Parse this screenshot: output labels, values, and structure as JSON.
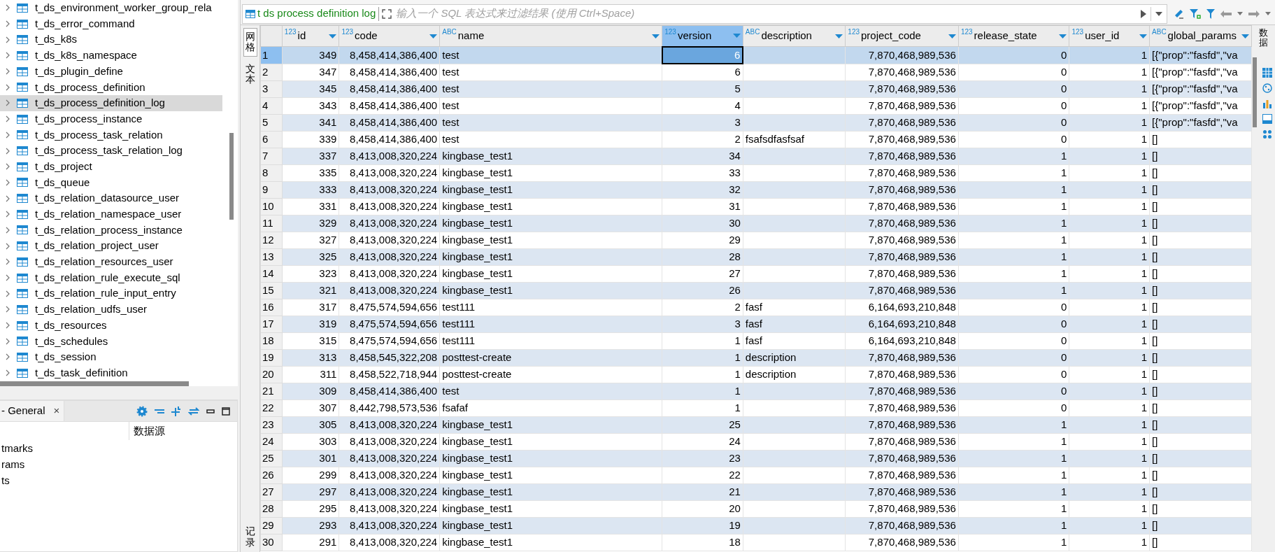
{
  "navigator": {
    "items": [
      {
        "label": "t_ds_environment_worker_group_rela",
        "selected": false
      },
      {
        "label": "t_ds_error_command",
        "selected": false
      },
      {
        "label": "t_ds_k8s",
        "selected": false
      },
      {
        "label": "t_ds_k8s_namespace",
        "selected": false
      },
      {
        "label": "t_ds_plugin_define",
        "selected": false
      },
      {
        "label": "t_ds_process_definition",
        "selected": false
      },
      {
        "label": "t_ds_process_definition_log",
        "selected": true
      },
      {
        "label": "t_ds_process_instance",
        "selected": false
      },
      {
        "label": "t_ds_process_task_relation",
        "selected": false
      },
      {
        "label": "t_ds_process_task_relation_log",
        "selected": false
      },
      {
        "label": "t_ds_project",
        "selected": false
      },
      {
        "label": "t_ds_queue",
        "selected": false
      },
      {
        "label": "t_ds_relation_datasource_user",
        "selected": false
      },
      {
        "label": "t_ds_relation_namespace_user",
        "selected": false
      },
      {
        "label": "t_ds_relation_process_instance",
        "selected": false
      },
      {
        "label": "t_ds_relation_project_user",
        "selected": false
      },
      {
        "label": "t_ds_relation_resources_user",
        "selected": false
      },
      {
        "label": "t_ds_relation_rule_execute_sql",
        "selected": false
      },
      {
        "label": "t_ds_relation_rule_input_entry",
        "selected": false
      },
      {
        "label": "t_ds_relation_udfs_user",
        "selected": false
      },
      {
        "label": "t_ds_resources",
        "selected": false
      },
      {
        "label": "t_ds_schedules",
        "selected": false
      },
      {
        "label": "t_ds_session",
        "selected": false
      },
      {
        "label": "t_ds_task_definition",
        "selected": false
      }
    ]
  },
  "bottom_panel": {
    "tab": "- General",
    "close": "×",
    "column_header": "数据源",
    "items": [
      "tmarks",
      "rams",
      "ts"
    ]
  },
  "editor": {
    "tab_title": "t ds process definition log",
    "filter": {
      "placeholder": "输入一个 SQL 表达式来过滤结果 (使用 Ctrl+Space)"
    },
    "side_tabs": [
      {
        "label": "网格",
        "selected": true
      },
      {
        "label": "文本",
        "selected": false
      }
    ],
    "side_tab_bottom": "记录",
    "right_tab": "数据",
    "columns": [
      {
        "type": "123",
        "label": "id",
        "selected": false
      },
      {
        "type": "123",
        "label": "code",
        "selected": false
      },
      {
        "type": "ABC",
        "label": "name",
        "selected": false
      },
      {
        "type": "123",
        "label": "version",
        "selected": true
      },
      {
        "type": "ABC",
        "label": "description",
        "selected": false
      },
      {
        "type": "123",
        "label": "project_code",
        "selected": false
      },
      {
        "type": "123",
        "label": "release_state",
        "selected": false
      },
      {
        "type": "123",
        "label": "user_id",
        "selected": false
      },
      {
        "type": "ABC",
        "label": "global_params",
        "selected": false
      }
    ],
    "rows": [
      {
        "n": "1",
        "cells": [
          "349",
          "8,458,414,386,400",
          "test",
          "6",
          null,
          "7,870,468,989,536",
          "0",
          "1",
          "[{\"prop\":\"fasfd\",\"va"
        ],
        "selected": true
      },
      {
        "n": "2",
        "cells": [
          "347",
          "8,458,414,386,400",
          "test",
          "6",
          null,
          "7,870,468,989,536",
          "0",
          "1",
          "[{\"prop\":\"fasfd\",\"va"
        ],
        "selected": false
      },
      {
        "n": "3",
        "cells": [
          "345",
          "8,458,414,386,400",
          "test",
          "5",
          null,
          "7,870,468,989,536",
          "0",
          "1",
          "[{\"prop\":\"fasfd\",\"va"
        ],
        "selected": false
      },
      {
        "n": "4",
        "cells": [
          "343",
          "8,458,414,386,400",
          "test",
          "4",
          null,
          "7,870,468,989,536",
          "0",
          "1",
          "[{\"prop\":\"fasfd\",\"va"
        ],
        "selected": false
      },
      {
        "n": "5",
        "cells": [
          "341",
          "8,458,414,386,400",
          "test",
          "3",
          null,
          "7,870,468,989,536",
          "0",
          "1",
          "[{\"prop\":\"fasfd\",\"va"
        ],
        "selected": false
      },
      {
        "n": "6",
        "cells": [
          "339",
          "8,458,414,386,400",
          "test",
          "2",
          "fsafsdfasfsaf",
          "7,870,468,989,536",
          "0",
          "1",
          "[]"
        ],
        "selected": false
      },
      {
        "n": "7",
        "cells": [
          "337",
          "8,413,008,320,224",
          "kingbase_test1",
          "34",
          null,
          "7,870,468,989,536",
          "1",
          "1",
          "[]"
        ],
        "selected": false
      },
      {
        "n": "8",
        "cells": [
          "335",
          "8,413,008,320,224",
          "kingbase_test1",
          "33",
          null,
          "7,870,468,989,536",
          "1",
          "1",
          "[]"
        ],
        "selected": false
      },
      {
        "n": "9",
        "cells": [
          "333",
          "8,413,008,320,224",
          "kingbase_test1",
          "32",
          null,
          "7,870,468,989,536",
          "1",
          "1",
          "[]"
        ],
        "selected": false
      },
      {
        "n": "10",
        "cells": [
          "331",
          "8,413,008,320,224",
          "kingbase_test1",
          "31",
          null,
          "7,870,468,989,536",
          "1",
          "1",
          "[]"
        ],
        "selected": false
      },
      {
        "n": "11",
        "cells": [
          "329",
          "8,413,008,320,224",
          "kingbase_test1",
          "30",
          null,
          "7,870,468,989,536",
          "1",
          "1",
          "[]"
        ],
        "selected": false
      },
      {
        "n": "12",
        "cells": [
          "327",
          "8,413,008,320,224",
          "kingbase_test1",
          "29",
          null,
          "7,870,468,989,536",
          "1",
          "1",
          "[]"
        ],
        "selected": false
      },
      {
        "n": "13",
        "cells": [
          "325",
          "8,413,008,320,224",
          "kingbase_test1",
          "28",
          null,
          "7,870,468,989,536",
          "1",
          "1",
          "[]"
        ],
        "selected": false
      },
      {
        "n": "14",
        "cells": [
          "323",
          "8,413,008,320,224",
          "kingbase_test1",
          "27",
          null,
          "7,870,468,989,536",
          "1",
          "1",
          "[]"
        ],
        "selected": false
      },
      {
        "n": "15",
        "cells": [
          "321",
          "8,413,008,320,224",
          "kingbase_test1",
          "26",
          null,
          "7,870,468,989,536",
          "1",
          "1",
          "[]"
        ],
        "selected": false
      },
      {
        "n": "16",
        "cells": [
          "317",
          "8,475,574,594,656",
          "test111",
          "2",
          "fasf",
          "6,164,693,210,848",
          "0",
          "1",
          "[]"
        ],
        "selected": false
      },
      {
        "n": "17",
        "cells": [
          "319",
          "8,475,574,594,656",
          "test111",
          "3",
          "fasf",
          "6,164,693,210,848",
          "0",
          "1",
          "[]"
        ],
        "selected": false
      },
      {
        "n": "18",
        "cells": [
          "315",
          "8,475,574,594,656",
          "test111",
          "1",
          "fasf",
          "6,164,693,210,848",
          "0",
          "1",
          "[]"
        ],
        "selected": false
      },
      {
        "n": "19",
        "cells": [
          "313",
          "8,458,545,322,208",
          "posttest-create",
          "1",
          "description",
          "7,870,468,989,536",
          "0",
          "1",
          "[]"
        ],
        "selected": false
      },
      {
        "n": "20",
        "cells": [
          "311",
          "8,458,522,718,944",
          "posttest-create",
          "1",
          "description",
          "7,870,468,989,536",
          "0",
          "1",
          "[]"
        ],
        "selected": false
      },
      {
        "n": "21",
        "cells": [
          "309",
          "8,458,414,386,400",
          "test",
          "1",
          null,
          "7,870,468,989,536",
          "0",
          "1",
          "[]"
        ],
        "selected": false
      },
      {
        "n": "22",
        "cells": [
          "307",
          "8,442,798,573,536",
          "fsafaf",
          "1",
          null,
          "7,870,468,989,536",
          "0",
          "1",
          "[]"
        ],
        "selected": false
      },
      {
        "n": "23",
        "cells": [
          "305",
          "8,413,008,320,224",
          "kingbase_test1",
          "25",
          null,
          "7,870,468,989,536",
          "1",
          "1",
          "[]"
        ],
        "selected": false
      },
      {
        "n": "24",
        "cells": [
          "303",
          "8,413,008,320,224",
          "kingbase_test1",
          "24",
          null,
          "7,870,468,989,536",
          "1",
          "1",
          "[]"
        ],
        "selected": false
      },
      {
        "n": "25",
        "cells": [
          "301",
          "8,413,008,320,224",
          "kingbase_test1",
          "23",
          null,
          "7,870,468,989,536",
          "1",
          "1",
          "[]"
        ],
        "selected": false
      },
      {
        "n": "26",
        "cells": [
          "299",
          "8,413,008,320,224",
          "kingbase_test1",
          "22",
          null,
          "7,870,468,989,536",
          "1",
          "1",
          "[]"
        ],
        "selected": false
      },
      {
        "n": "27",
        "cells": [
          "297",
          "8,413,008,320,224",
          "kingbase_test1",
          "21",
          null,
          "7,870,468,989,536",
          "1",
          "1",
          "[]"
        ],
        "selected": false
      },
      {
        "n": "28",
        "cells": [
          "295",
          "8,413,008,320,224",
          "kingbase_test1",
          "20",
          null,
          "7,870,468,989,536",
          "1",
          "1",
          "[]"
        ],
        "selected": false
      },
      {
        "n": "29",
        "cells": [
          "293",
          "8,413,008,320,224",
          "kingbase_test1",
          "19",
          null,
          "7,870,468,989,536",
          "1",
          "1",
          "[]"
        ],
        "selected": false
      },
      {
        "n": "30",
        "cells": [
          "291",
          "8,413,008,320,224",
          "kingbase_test1",
          "18",
          null,
          "7,870,468,989,536",
          "1",
          "1",
          "[]"
        ],
        "selected": false
      }
    ]
  }
}
